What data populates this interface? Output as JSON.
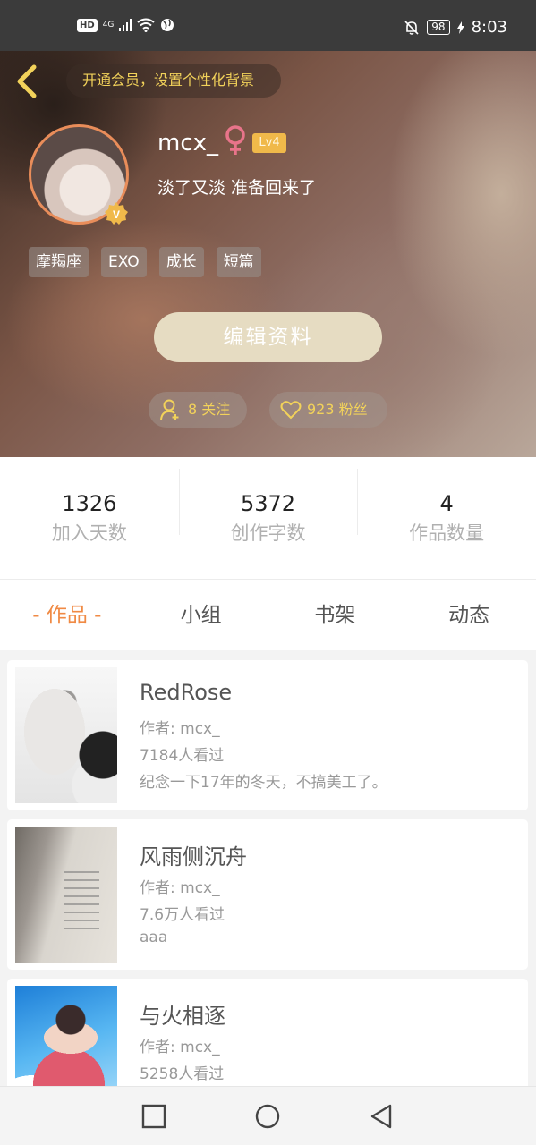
{
  "status_bar": {
    "hd": "HD",
    "network": "4G",
    "battery": "98",
    "time": "8:03"
  },
  "header": {
    "vip_banner": "开通会员，设置个性化背景",
    "username": "mcx_",
    "level": "Lv4",
    "signature": "淡了又淡 准备回来了",
    "tags": [
      "摩羯座",
      "EXO",
      "成长",
      "短篇"
    ],
    "edit_button": "编辑资料",
    "follow_text": "8 关注",
    "fans_text": "923 粉丝",
    "accent_color": "#f2d25a"
  },
  "stats": [
    {
      "value": "1326",
      "label": "加入天数"
    },
    {
      "value": "5372",
      "label": "创作字数"
    },
    {
      "value": "4",
      "label": "作品数量"
    }
  ],
  "tabs": [
    {
      "label": "- 作品 -",
      "active": true
    },
    {
      "label": "小组",
      "active": false
    },
    {
      "label": "书架",
      "active": false
    },
    {
      "label": "动态",
      "active": false
    }
  ],
  "works": [
    {
      "title": "RedRose",
      "author": "作者: mcx_",
      "views": "7184人看过",
      "desc": "纪念一下17年的冬天，不搞美工了。"
    },
    {
      "title": "风雨侧沉舟",
      "author": "作者: mcx_",
      "views": "7.6万人看过",
      "desc": "aaa"
    },
    {
      "title": "与火相逐",
      "author": "作者: mcx_",
      "views": "5258人看过",
      "desc": ""
    }
  ],
  "colors": {
    "tab_active": "#f08a44",
    "level_badge": "#f0b94a",
    "edit_button_bg": "#e6dcc2"
  }
}
